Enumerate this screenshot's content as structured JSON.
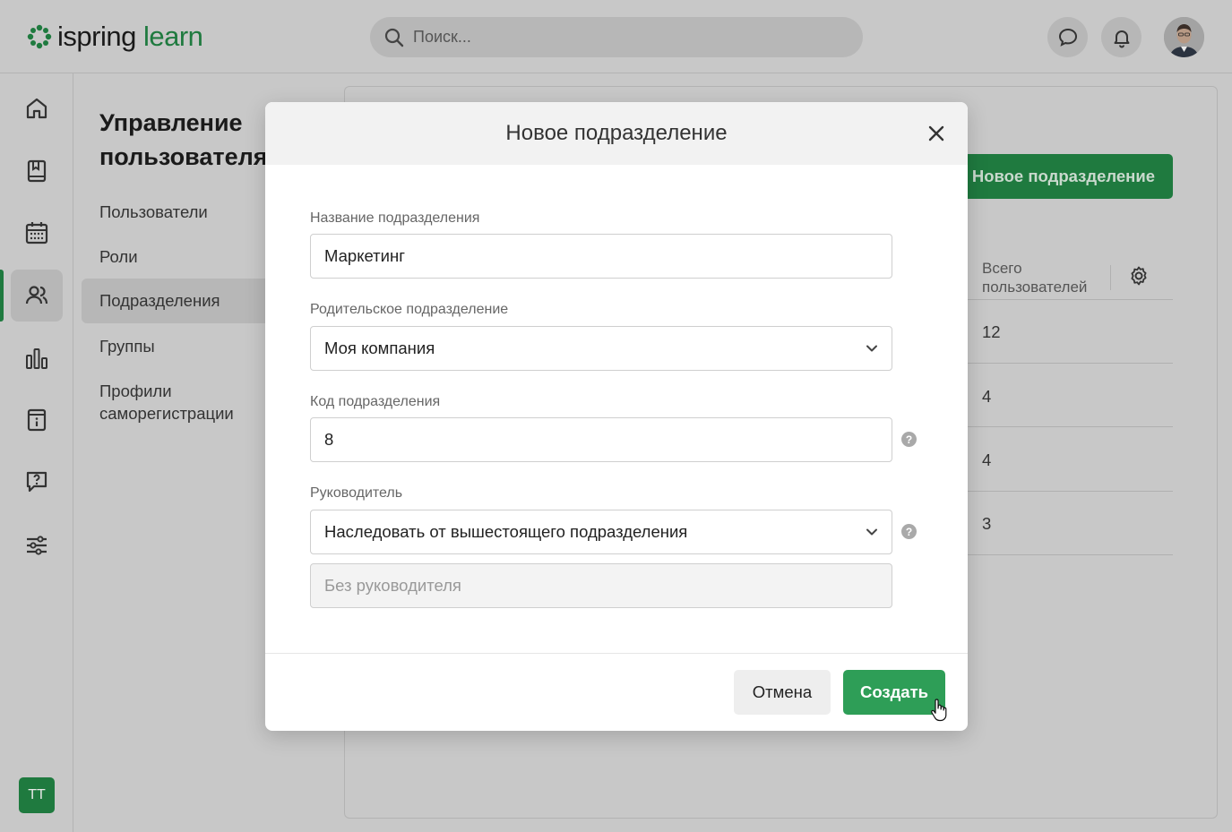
{
  "app": {
    "logo_part1": "ispring",
    "logo_part2": "learn"
  },
  "search": {
    "placeholder": "Поиск..."
  },
  "colors": {
    "brand": "#1f7a3f",
    "primary_button": "#2e9e57"
  },
  "rail": {
    "items": [
      "home-icon",
      "book-icon",
      "calendar-icon",
      "users-icon",
      "chart-icon",
      "info-book-icon",
      "help-chat-icon",
      "sliders-icon"
    ],
    "active": "users-icon",
    "user_initials": "TT"
  },
  "subnav": {
    "title": "Управление пользователями",
    "items": [
      "Пользователи",
      "Роли",
      "Подразделения",
      "Группы",
      "Профили саморегистрации"
    ],
    "active": "Подразделения"
  },
  "content": {
    "new_button": "Новое подразделение",
    "column_header": "Всего пользователей",
    "rows": [
      "12",
      "4",
      "4",
      "3"
    ]
  },
  "modal": {
    "title": "Новое подразделение",
    "fields": {
      "name_label": "Название подразделения",
      "name_value": "Маркетинг",
      "parent_label": "Родительское подразделение",
      "parent_value": "Моя компания",
      "code_label": "Код подразделения",
      "code_value": "8",
      "manager_label": "Руководитель",
      "manager_value": "Наследовать от вышестоящего подразделения",
      "manager_placeholder": "Без руководителя"
    },
    "help_glyph": "?",
    "cancel": "Отмена",
    "create": "Создать"
  }
}
